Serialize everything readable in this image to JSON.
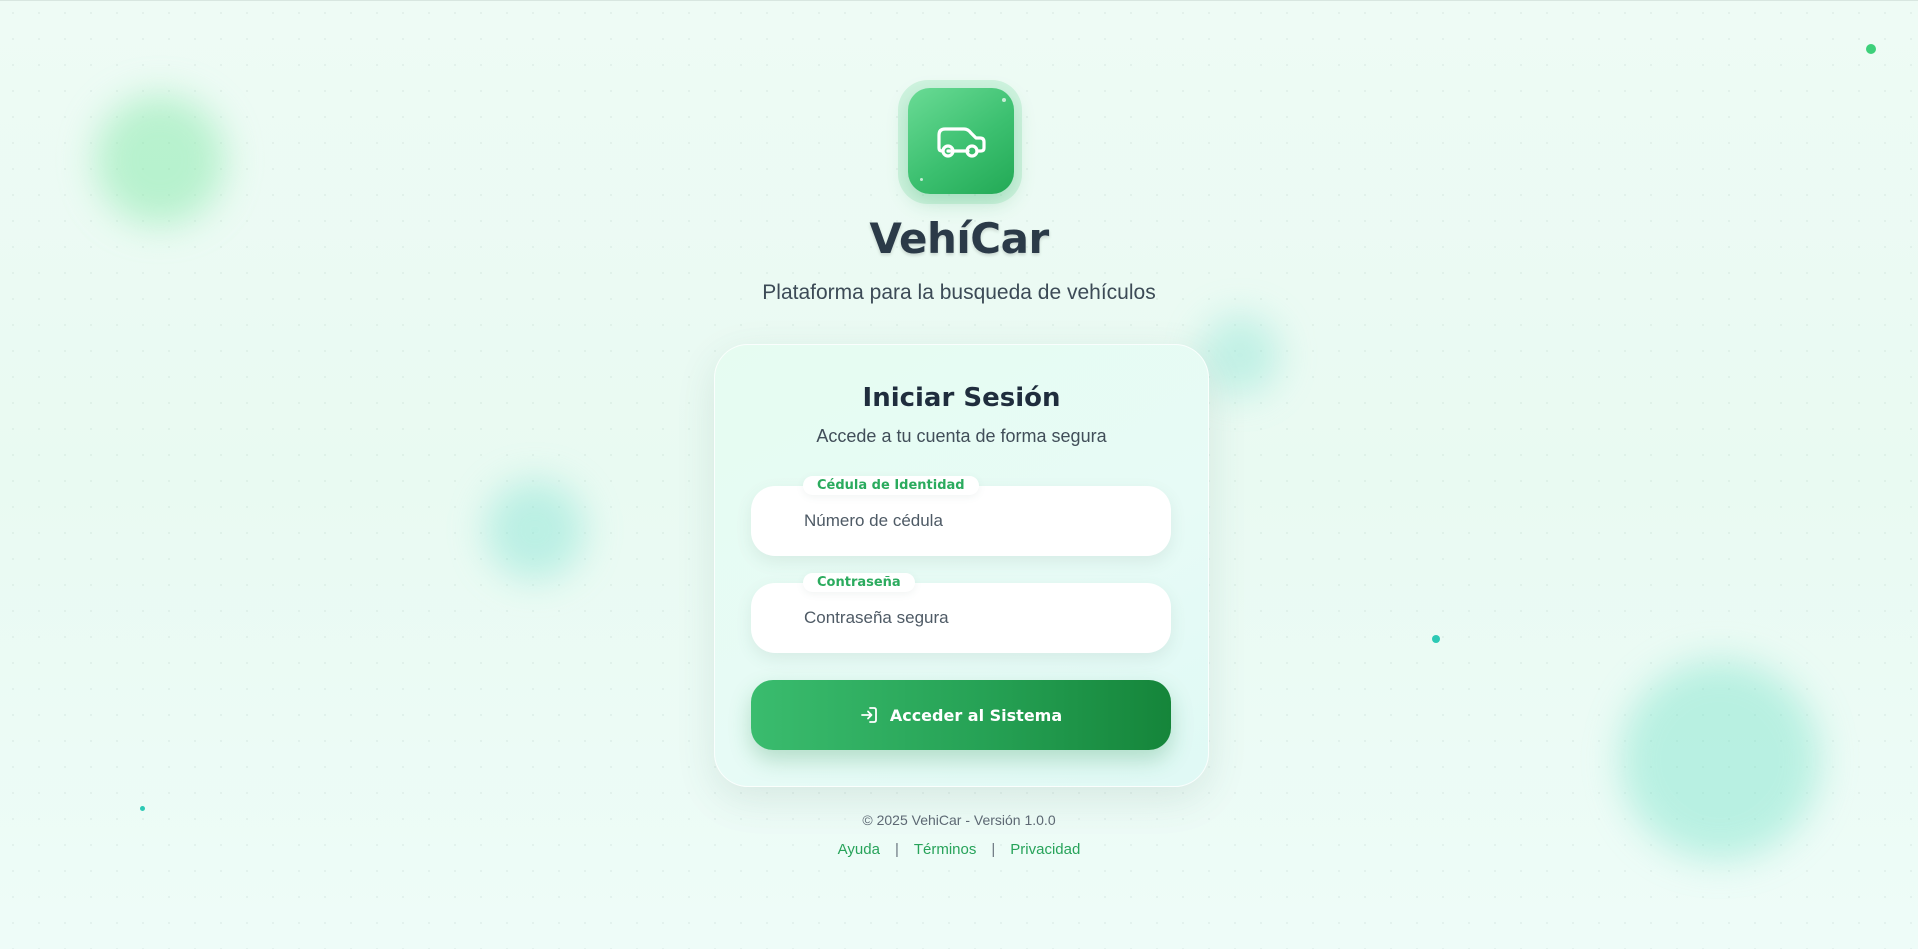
{
  "app": {
    "name": "VehíCar",
    "subtitle": "Plataforma para la busqueda de vehículos",
    "logo_icon": "car-icon"
  },
  "login": {
    "title": "Iniciar Sesión",
    "subtitle": "Accede a tu cuenta de forma segura",
    "id_field": {
      "label": "Cédula de Identidad",
      "placeholder": "Número de cédula",
      "value": ""
    },
    "password_field": {
      "label": "Contraseña",
      "placeholder": "Contraseña segura",
      "value": ""
    },
    "submit_label": "Acceder al Sistema",
    "submit_icon": "login-icon"
  },
  "footer": {
    "copyright": "© 2025 VehiCar - Versión 1.0.0",
    "links": [
      "Ayuda",
      "Términos",
      "Privacidad"
    ]
  },
  "colors": {
    "accent": "#2bab5e",
    "button_start": "#3abc6e",
    "button_end": "#15853a",
    "title": "#2b3a48",
    "background": "#eefbf5"
  }
}
